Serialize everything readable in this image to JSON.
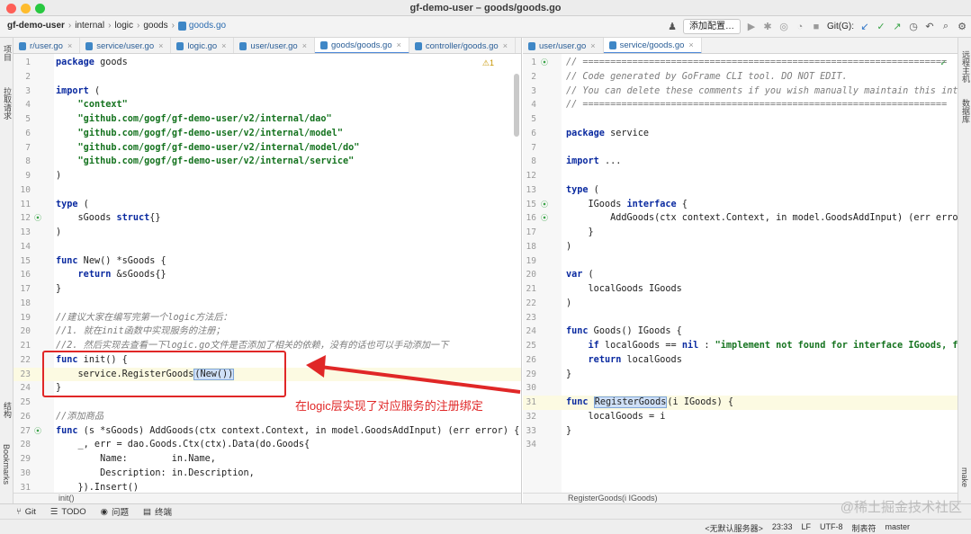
{
  "window": {
    "title": "gf-demo-user – goods/goods.go"
  },
  "breadcrumb": [
    "gf-demo-user",
    "internal",
    "logic",
    "goods",
    "goods.go"
  ],
  "toolbar": {
    "run_config": "添加配置…",
    "git_label": "Git(G):"
  },
  "left_strip": {
    "project": "项目",
    "pull_requests": "拉取请求",
    "structure": "结构",
    "bookmarks": "Bookmarks"
  },
  "right_strip": {
    "remote_host": "远程主机",
    "database": "数据库",
    "make": "make"
  },
  "left_tabs": [
    {
      "label": "r/user.go"
    },
    {
      "label": "service/user.go"
    },
    {
      "label": "logic.go"
    },
    {
      "label": "user/user.go"
    },
    {
      "label": "goods/goods.go",
      "active": true
    },
    {
      "label": "controller/goods.go"
    }
  ],
  "right_tabs": [
    {
      "label": "user/user.go"
    },
    {
      "label": "service/goods.go",
      "active": true
    }
  ],
  "left_code": [
    {
      "n": "1",
      "t": "package goods"
    },
    {
      "n": "2",
      "t": ""
    },
    {
      "n": "3",
      "t": "import ("
    },
    {
      "n": "4",
      "t": "    \"context\""
    },
    {
      "n": "5",
      "t": "    \"github.com/gogf/gf-demo-user/v2/internal/dao\""
    },
    {
      "n": "6",
      "t": "    \"github.com/gogf/gf-demo-user/v2/internal/model\""
    },
    {
      "n": "7",
      "t": "    \"github.com/gogf/gf-demo-user/v2/internal/model/do\""
    },
    {
      "n": "8",
      "t": "    \"github.com/gogf/gf-demo-user/v2/internal/service\""
    },
    {
      "n": "9",
      "t": ")"
    },
    {
      "n": "10",
      "t": ""
    },
    {
      "n": "11",
      "t": "type ("
    },
    {
      "n": "12",
      "t": "    sGoods struct{}"
    },
    {
      "n": "13",
      "t": ")"
    },
    {
      "n": "14",
      "t": ""
    },
    {
      "n": "15",
      "t": "func New() *sGoods {"
    },
    {
      "n": "16",
      "t": "    return &sGoods{}"
    },
    {
      "n": "17",
      "t": "}"
    },
    {
      "n": "18",
      "t": ""
    },
    {
      "n": "19",
      "t": "//建议大家在编写完第一个logic方法后："
    },
    {
      "n": "20",
      "t": "//1. 就在init函数中实现服务的注册；"
    },
    {
      "n": "21",
      "t": "//2. 然后实现去查看一下logic.go文件是否添加了相关的依赖，没有的话也可以手动添加一下"
    },
    {
      "n": "22",
      "t": "func init() {"
    },
    {
      "n": "23",
      "t": "    service.RegisterGoods(New())"
    },
    {
      "n": "24",
      "t": "}"
    },
    {
      "n": "25",
      "t": ""
    },
    {
      "n": "26",
      "t": "//添加商品"
    },
    {
      "n": "27",
      "t": "func (s *sGoods) AddGoods(ctx context.Context, in model.GoodsAddInput) (err error) {"
    },
    {
      "n": "28",
      "t": "    _, err = dao.Goods.Ctx(ctx).Data(do.Goods{"
    },
    {
      "n": "29",
      "t": "        Name:        in.Name,"
    },
    {
      "n": "30",
      "t": "        Description: in.Description,"
    },
    {
      "n": "31",
      "t": "    }).Insert()"
    }
  ],
  "right_code": [
    {
      "n": "1",
      "t": "// =================================================================="
    },
    {
      "n": "2",
      "t": "// Code generated by GoFrame CLI tool. DO NOT EDIT."
    },
    {
      "n": "3",
      "t": "// You can delete these comments if you wish manually maintain this interface file."
    },
    {
      "n": "4",
      "t": "// =================================================================="
    },
    {
      "n": "5",
      "t": ""
    },
    {
      "n": "6",
      "t": "package service"
    },
    {
      "n": "7",
      "t": ""
    },
    {
      "n": "8",
      "t": "import ..."
    },
    {
      "n": "12",
      "t": ""
    },
    {
      "n": "13",
      "t": "type ("
    },
    {
      "n": "15",
      "t": "    IGoods interface {"
    },
    {
      "n": "16",
      "t": "        AddGoods(ctx context.Context, in model.GoodsAddInput) (err error)"
    },
    {
      "n": "17",
      "t": "    }"
    },
    {
      "n": "18",
      "t": ")"
    },
    {
      "n": "19",
      "t": ""
    },
    {
      "n": "20",
      "t": "var ("
    },
    {
      "n": "21",
      "t": "    localGoods IGoods"
    },
    {
      "n": "22",
      "t": ")"
    },
    {
      "n": "23",
      "t": ""
    },
    {
      "n": "24",
      "t": "func Goods() IGoods {"
    },
    {
      "n": "25",
      "t": "    if localGoods == nil : \"implement not found for interface IGoods, forgot register?\""
    },
    {
      "n": "26",
      "t": "    return localGoods"
    },
    {
      "n": "29",
      "t": "}"
    },
    {
      "n": "30",
      "t": ""
    },
    {
      "n": "31",
      "t": "func RegisterGoods(i IGoods) {"
    },
    {
      "n": "32",
      "t": "    localGoods = i"
    },
    {
      "n": "33",
      "t": "}"
    },
    {
      "n": "34",
      "t": ""
    }
  ],
  "left_status": "init()",
  "right_status": "RegisterGoods(i IGoods)",
  "inspection": {
    "warnings": "⚠1"
  },
  "annotation": {
    "text": "在logic层实现了对应服务的注册绑定"
  },
  "bottom_tools": [
    {
      "label": "Git"
    },
    {
      "label": "TODO"
    },
    {
      "label": "问题"
    },
    {
      "label": "终端"
    }
  ],
  "status_bar": {
    "interpreter": "<无默认服务器>",
    "position": "23:33",
    "line_sep": "LF",
    "encoding": "UTF-8",
    "indent": "制表符",
    "branch": "master"
  },
  "watermark": "@稀土掘金技术社区"
}
